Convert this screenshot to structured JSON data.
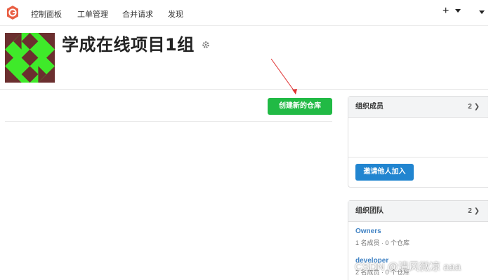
{
  "navbar": {
    "items": [
      {
        "label": "控制面板"
      },
      {
        "label": "工单管理"
      },
      {
        "label": "合并请求"
      },
      {
        "label": "发现"
      }
    ],
    "create_label": "+",
    "logo_color": "#e95f44"
  },
  "org": {
    "title": "学成在线项目1组",
    "avatar_colors": {
      "bg": "#3fea2a",
      "fg": "#6b2f2f"
    }
  },
  "main": {
    "create_repo_label": "创建新的仓库",
    "create_repo_color": "#21ba45"
  },
  "members_panel": {
    "title": "组织成员",
    "count": "2",
    "invite_label": "邀请他人加入",
    "invite_color": "#2185d0"
  },
  "teams_panel": {
    "title": "组织团队",
    "count": "2",
    "teams": [
      {
        "name": "Owners",
        "meta": "1 名成员 · 0 个仓库"
      },
      {
        "name": "developer",
        "meta": "2 名成员 · 0 个仓库"
      }
    ]
  },
  "watermark": "CSDN @清风微凉 aaa"
}
